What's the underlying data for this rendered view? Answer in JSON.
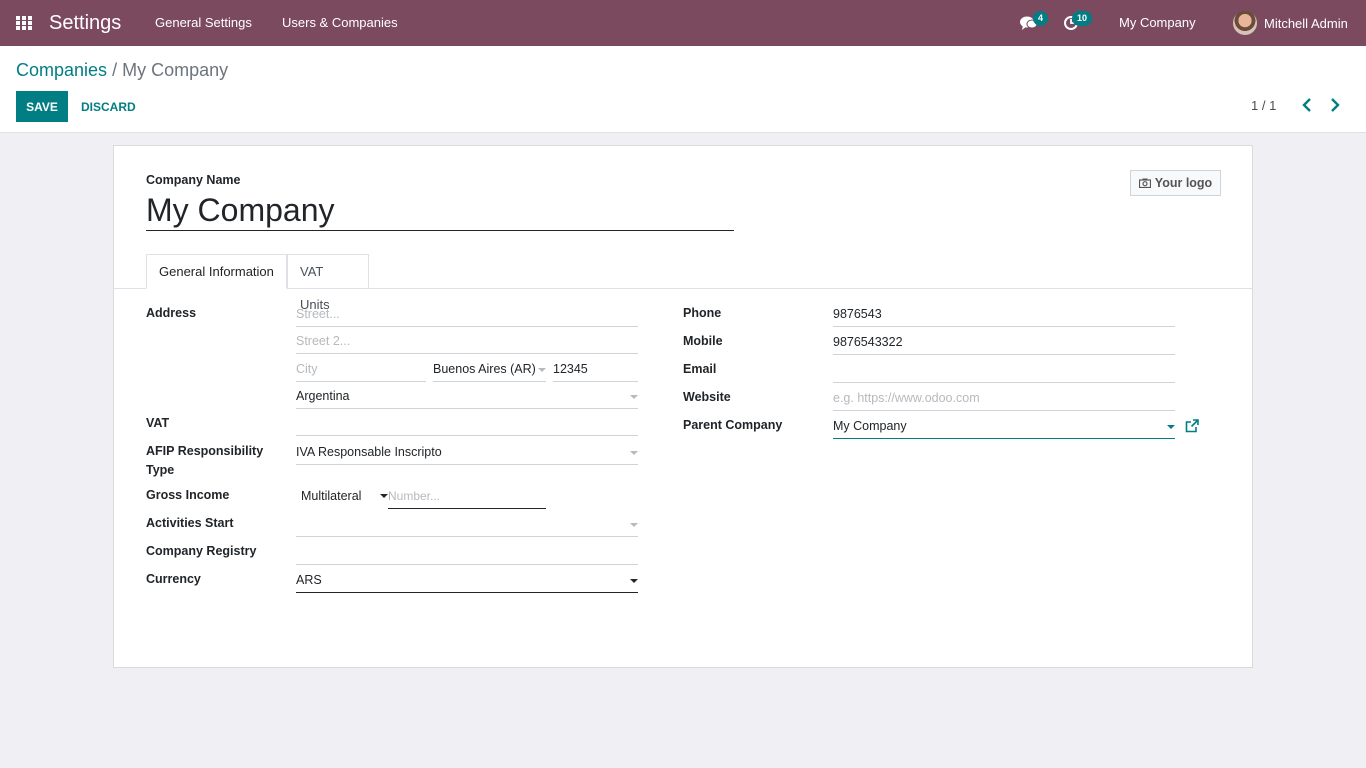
{
  "navbar": {
    "app_title": "Settings",
    "menu": [
      "General Settings",
      "Users & Companies"
    ],
    "messages_count": "4",
    "activities_count": "10",
    "company": "My Company",
    "user": "Mitchell Admin"
  },
  "breadcrumb": {
    "parent": "Companies",
    "separator": "/",
    "current": "My Company"
  },
  "actions": {
    "save": "SAVE",
    "discard": "DISCARD"
  },
  "pager": {
    "value": "1 / 1"
  },
  "form": {
    "name_label": "Company Name",
    "name_value": "My Company",
    "logo_button": "Your logo",
    "tabs": [
      "General Information",
      "VAT Units"
    ],
    "left": {
      "address_label": "Address",
      "street_placeholder": "Street...",
      "street2_placeholder": "Street 2...",
      "city_placeholder": "City",
      "state_value": "Buenos Aires (AR)",
      "zip_value": "12345",
      "country_value": "Argentina",
      "vat_label": "VAT",
      "vat_value": "",
      "afip_label": "AFIP Responsibility Type",
      "afip_value": "IVA Responsable Inscripto",
      "gross_income_label": "Gross Income",
      "gross_income_type": "Multilateral",
      "gross_income_placeholder": "Number...",
      "activities_label": "Activities Start",
      "activities_value": "",
      "registry_label": "Company Registry",
      "registry_value": "",
      "currency_label": "Currency",
      "currency_value": "ARS"
    },
    "right": {
      "phone_label": "Phone",
      "phone_value": "9876543",
      "mobile_label": "Mobile",
      "mobile_value": "9876543322",
      "email_label": "Email",
      "email_value": "",
      "website_label": "Website",
      "website_placeholder": "e.g. https://www.odoo.com",
      "parent_label": "Parent Company",
      "parent_value": "My Company"
    }
  },
  "colors": {
    "navbar": "#7c4a5f",
    "accent": "#017e84"
  },
  "icons": {
    "apps": "apps-grid-icon",
    "messages": "chat-icon",
    "activities": "clock-icon",
    "prev": "chevron-left-icon",
    "next": "chevron-right-icon",
    "logo": "camera-icon",
    "external": "external-link-icon"
  }
}
